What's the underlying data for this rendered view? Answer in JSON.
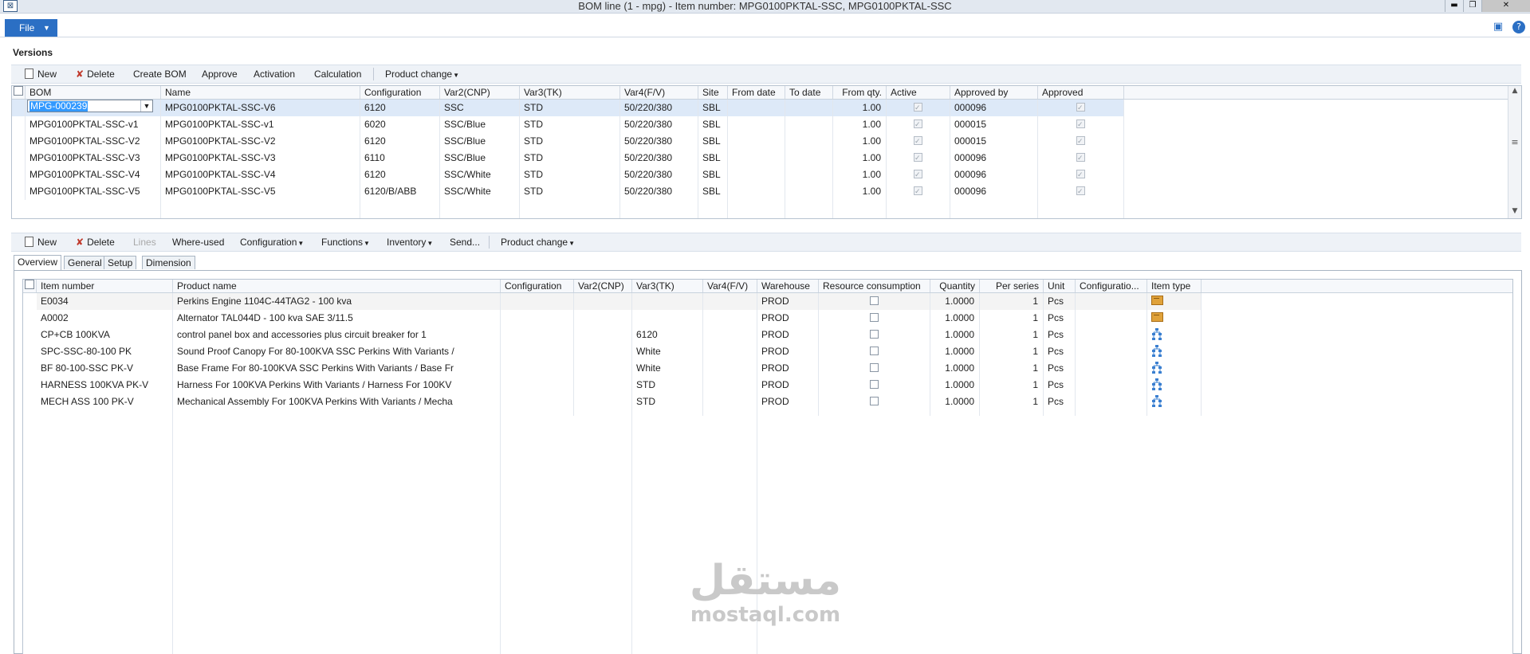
{
  "window": {
    "title": "BOM line (1 - mpg) - Item number: MPG0100PKTAL-SSC, MPG0100PKTAL-SSC",
    "file_label": "File"
  },
  "versions": {
    "section_title": "Versions",
    "toolbar": {
      "new": "New",
      "delete": "Delete",
      "create_bom": "Create BOM",
      "approve": "Approve",
      "activation": "Activation",
      "calculation": "Calculation",
      "product_change": "Product change"
    },
    "columns": [
      "BOM",
      "Name",
      "Configuration",
      "Var2(CNP)",
      "Var3(TK)",
      "Var4(F/V)",
      "Site",
      "From date",
      "To date",
      "From qty.",
      "Active",
      "Approved by",
      "Approved"
    ],
    "rows": [
      {
        "bom": "MPG-000239",
        "name": "MPG0100PKTAL-SSC-V6",
        "config": "6120",
        "var2": "SSC",
        "var3": "STD",
        "var4": "50/220/380",
        "site": "SBL",
        "from_date": "",
        "to_date": "",
        "from_qty": "1.00",
        "active": true,
        "approved_by": "000096",
        "approved": true
      },
      {
        "bom": "MPG0100PKTAL-SSC-v1",
        "name": "MPG0100PKTAL-SSC-v1",
        "config": "6020",
        "var2": "SSC/Blue",
        "var3": "STD",
        "var4": "50/220/380",
        "site": "SBL",
        "from_date": "",
        "to_date": "",
        "from_qty": "1.00",
        "active": true,
        "approved_by": "000015",
        "approved": true
      },
      {
        "bom": "MPG0100PKTAL-SSC-V2",
        "name": "MPG0100PKTAL-SSC-V2",
        "config": "6120",
        "var2": "SSC/Blue",
        "var3": "STD",
        "var4": "50/220/380",
        "site": "SBL",
        "from_date": "",
        "to_date": "",
        "from_qty": "1.00",
        "active": true,
        "approved_by": "000015",
        "approved": true
      },
      {
        "bom": "MPG0100PKTAL-SSC-V3",
        "name": "MPG0100PKTAL-SSC-V3",
        "config": "6110",
        "var2": "SSC/Blue",
        "var3": "STD",
        "var4": "50/220/380",
        "site": "SBL",
        "from_date": "",
        "to_date": "",
        "from_qty": "1.00",
        "active": true,
        "approved_by": "000096",
        "approved": true
      },
      {
        "bom": "MPG0100PKTAL-SSC-V4",
        "name": "MPG0100PKTAL-SSC-V4",
        "config": "6120",
        "var2": "SSC/White",
        "var3": "STD",
        "var4": "50/220/380",
        "site": "SBL",
        "from_date": "",
        "to_date": "",
        "from_qty": "1.00",
        "active": true,
        "approved_by": "000096",
        "approved": true
      },
      {
        "bom": "MPG0100PKTAL-SSC-V5",
        "name": "MPG0100PKTAL-SSC-V5",
        "config": "6120/B/ABB",
        "var2": "SSC/White",
        "var3": "STD",
        "var4": "50/220/380",
        "site": "SBL",
        "from_date": "",
        "to_date": "",
        "from_qty": "1.00",
        "active": true,
        "approved_by": "000096",
        "approved": true
      }
    ]
  },
  "lines": {
    "toolbar": {
      "new": "New",
      "delete": "Delete",
      "lines": "Lines",
      "where_used": "Where-used",
      "configuration": "Configuration",
      "functions": "Functions",
      "inventory": "Inventory",
      "send": "Send...",
      "product_change": "Product change"
    },
    "tabs": [
      "Overview",
      "General",
      "Setup",
      "Dimension"
    ],
    "columns": [
      "Item number",
      "Product name",
      "Configuration",
      "Var2(CNP)",
      "Var3(TK)",
      "Var4(F/V)",
      "Warehouse",
      "Resource consumption",
      "Quantity",
      "Per series",
      "Unit",
      "Configuratio...",
      "Item type"
    ],
    "rows": [
      {
        "item": "E0034",
        "product": "Perkins Engine 1104C-44TAG2 - 100 kva",
        "config": "",
        "var2": "",
        "var3": "",
        "var4": "",
        "warehouse": "PROD",
        "resource": false,
        "qty": "1.0000",
        "per_series": "1",
        "unit": "Pcs",
        "configuratio": "",
        "item_type_icon": "item-box-icon"
      },
      {
        "item": "A0002",
        "product": "Alternator TAL044D - 100 kva  SAE 3/11.5",
        "config": "",
        "var2": "",
        "var3": "",
        "var4": "",
        "warehouse": "PROD",
        "resource": false,
        "qty": "1.0000",
        "per_series": "1",
        "unit": "Pcs",
        "configuratio": "",
        "item_type_icon": "item-box-icon"
      },
      {
        "item": "CP+CB 100KVA",
        "product": "control panel box and accessories plus circuit breaker for 1",
        "config": "",
        "var2": "",
        "var3": "6120",
        "var4": "",
        "warehouse": "PROD",
        "resource": false,
        "qty": "1.0000",
        "per_series": "1",
        "unit": "Pcs",
        "configuratio": "",
        "item_type_icon": "bom-tree-icon"
      },
      {
        "item": "SPC-SSC-80-100 PK",
        "product": "Sound Proof Canopy For 80-100KVA SSC Perkins With Variants /",
        "config": "",
        "var2": "",
        "var3": "White",
        "var4": "",
        "warehouse": "PROD",
        "resource": false,
        "qty": "1.0000",
        "per_series": "1",
        "unit": "Pcs",
        "configuratio": "",
        "item_type_icon": "bom-tree-icon"
      },
      {
        "item": "BF 80-100-SSC PK-V",
        "product": "Base Frame For 80-100KVA SSC Perkins With Variants / Base Fr",
        "config": "",
        "var2": "",
        "var3": "White",
        "var4": "",
        "warehouse": "PROD",
        "resource": false,
        "qty": "1.0000",
        "per_series": "1",
        "unit": "Pcs",
        "configuratio": "",
        "item_type_icon": "bom-tree-icon"
      },
      {
        "item": "HARNESS 100KVA PK-V",
        "product": "Harness For 100KVA Perkins With Variants / Harness For 100KV",
        "config": "",
        "var2": "",
        "var3": "STD",
        "var4": "",
        "warehouse": "PROD",
        "resource": false,
        "qty": "1.0000",
        "per_series": "1",
        "unit": "Pcs",
        "configuratio": "",
        "item_type_icon": "bom-tree-icon"
      },
      {
        "item": "MECH ASS 100 PK-V",
        "product": "Mechanical Assembly For 100KVA Perkins With Variants / Mecha",
        "config": "",
        "var2": "",
        "var3": "STD",
        "var4": "",
        "warehouse": "PROD",
        "resource": false,
        "qty": "1.0000",
        "per_series": "1",
        "unit": "Pcs",
        "configuratio": "",
        "item_type_icon": "bom-tree-icon"
      }
    ]
  },
  "watermark": {
    "arabic": "مستقل",
    "latin": "mostaql.com"
  }
}
